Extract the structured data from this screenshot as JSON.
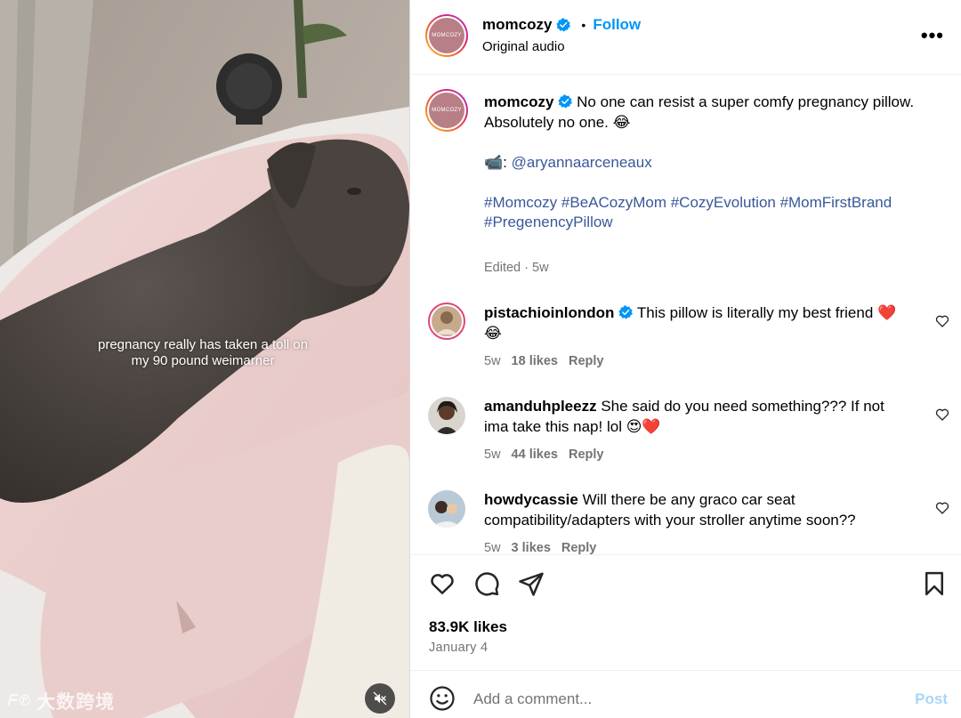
{
  "media": {
    "overlay_text": "pregnancy really has taken a toll on my 90 pound weimarner",
    "watermark_mark": "ᖴ℗",
    "watermark_text": "大数跨境"
  },
  "header": {
    "avatar_text": "MOMCOZY",
    "username": "momcozy",
    "separator": "•",
    "follow_label": "Follow",
    "audio_label": "Original audio",
    "more_label": "•••"
  },
  "caption": {
    "avatar_text": "MOMCOZY",
    "username": "momcozy",
    "line1": "No one can resist a super comfy pregnancy pillow.",
    "line2": "Absolutely no one. 😂",
    "credit_emoji": "📹:",
    "credit_handle": "@aryannaarceneaux",
    "hashtags": "#Momcozy #BeACozyMom #CozyEvolution #MomFirstBrand #PregenencyPillow",
    "meta": "Edited · 5w"
  },
  "comments": [
    {
      "username": "pistachioinlondon",
      "text": "This pillow is literally my best friend ❤️ 😂",
      "time": "5w",
      "likes": "18 likes",
      "reply": "Reply"
    },
    {
      "username": "amanduhpleezz",
      "text": "She said do you need something??? If not ima take this nap! lol 😍❤️",
      "time": "5w",
      "likes": "44 likes",
      "reply": "Reply"
    },
    {
      "username": "howdycassie",
      "text": "Will there be any graco car seat compatibility/adapters with your stroller anytime soon??",
      "time": "5w",
      "likes": "3 likes",
      "reply": "Reply"
    }
  ],
  "actions": {
    "likes_count": "83.9K likes",
    "date": "January 4"
  },
  "comment_bar": {
    "placeholder": "Add a comment...",
    "post_label": "Post"
  },
  "colors": {
    "accent": "#0095f6",
    "link": "#385898",
    "muted": "#737373",
    "post_disabled": "#a8d6f8"
  }
}
